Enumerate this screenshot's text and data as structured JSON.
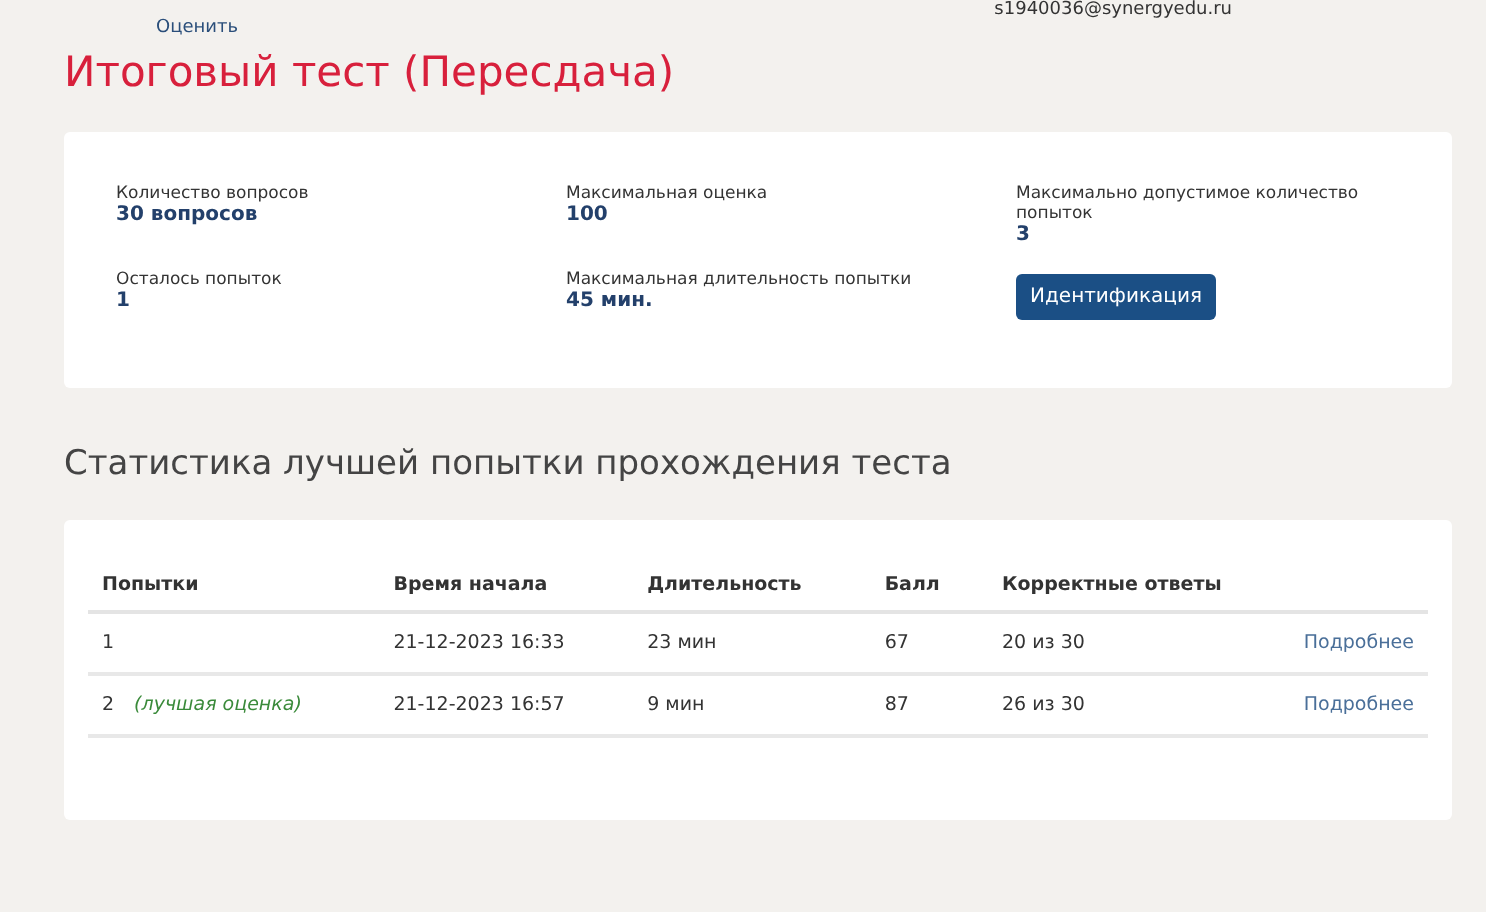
{
  "header": {
    "rate_link": "Оценить",
    "email": "s1940036@synergyedu.ru"
  },
  "title": "Итоговый тест (Пересдача)",
  "info": [
    {
      "label": "Количество вопросов",
      "value": "30 вопросов"
    },
    {
      "label": "Максимальная оценка",
      "value": "100"
    },
    {
      "label": "Максимально допустимое количество попыток",
      "value": "3"
    },
    {
      "label": "Осталось попыток",
      "value": "1"
    },
    {
      "label": "Максимальная длительность попытки",
      "value": "45 мин."
    }
  ],
  "identify_button": "Идентификация",
  "stats_title": "Статистика лучшей попытки прохождения теста",
  "table": {
    "columns": [
      "Попытки",
      "Время начала",
      "Длительность",
      "Балл",
      "Корректные ответы"
    ],
    "rows": [
      {
        "attempt": "1",
        "start": "21-12-2023 16:33",
        "duration": "23 мин",
        "score": "67",
        "correct": "20 из 30",
        "link": "Подробнее"
      },
      {
        "attempt": "2",
        "note": "(лучшая оценка)",
        "start": "21-12-2023 16:57",
        "duration": "9 мин",
        "score": "87",
        "correct": "26 из 30",
        "link": "Подробнее"
      }
    ]
  }
}
